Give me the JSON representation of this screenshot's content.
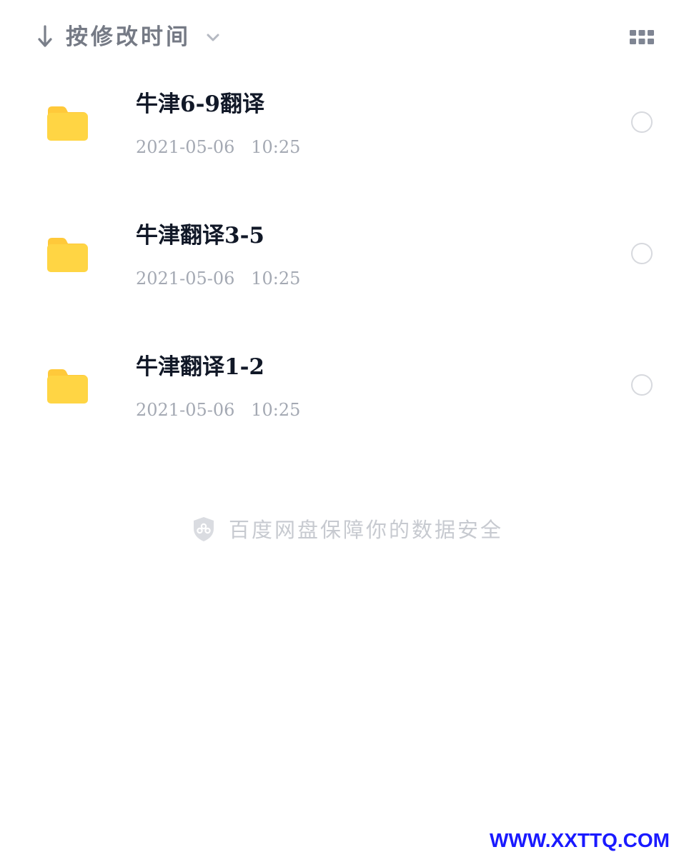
{
  "sort": {
    "label": "按修改时间",
    "arrow_icon": "arrow-down-icon",
    "chevron_icon": "chevron-down-icon"
  },
  "view_toggle": {
    "icon": "grid-view-icon"
  },
  "files": [
    {
      "name": "牛津6-9翻译",
      "date": "2021-05-06",
      "time": "10:25",
      "icon": "folder-icon"
    },
    {
      "name": "牛津翻译3-5",
      "date": "2021-05-06",
      "time": "10:25",
      "icon": "folder-icon"
    },
    {
      "name": "牛津翻译1-2",
      "date": "2021-05-06",
      "time": "10:25",
      "icon": "folder-icon"
    }
  ],
  "footer": {
    "text": "百度网盘保障你的数据安全",
    "icon": "shield-icon"
  },
  "watermark": {
    "text": "WWW.XXTTQ.COM"
  },
  "colors": {
    "folder": "#ffd544",
    "folder_tab": "#ffc93a",
    "title": "#111827",
    "meta": "#a4a9b3",
    "sort_text": "#757a85",
    "watermark": "#1a1aff"
  }
}
